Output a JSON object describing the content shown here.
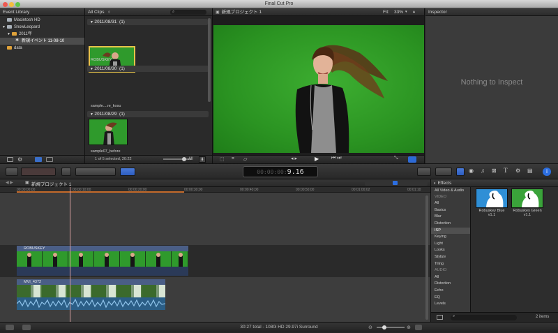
{
  "window": {
    "title": "Final Cut Pro"
  },
  "event_library": {
    "title": "Event Library",
    "items": [
      {
        "label": "Macintosh HD"
      },
      {
        "label": "SnowLeopard"
      },
      {
        "label": "2011年"
      },
      {
        "label": "新規イベント 11-08-10"
      },
      {
        "label": "data"
      }
    ]
  },
  "browser": {
    "filter": "All Clips",
    "groups": [
      {
        "date": "2011/08/31",
        "count": "(1)",
        "clip": "ROBUSKEY"
      },
      {
        "date": "2011/08/30",
        "count": "(1)",
        "clip": "sample....re_kosu"
      },
      {
        "date": "2011/08/29",
        "count": "(1)",
        "clip": "sample07_before"
      }
    ],
    "selection_status": "1 of 5 selected, 20:22",
    "filter_menu": "All"
  },
  "viewer": {
    "project_name": "新規プロジェクト 1",
    "fit_label": "Fit:",
    "zoom": "33%"
  },
  "inspector": {
    "title": "Inspector",
    "empty_text": "Nothing to Inspect"
  },
  "toolbar": {
    "timecode": "9.16"
  },
  "timeline": {
    "project_name": "新規プロジェクト 1",
    "ruler": [
      "00:00:00;00",
      "00:00:10;00",
      "00:00:20;00",
      "00:00:30;00",
      "00:00:40;00",
      "00:00:50;00",
      "00:01:00;02",
      "00:01:10"
    ],
    "connected_clip": "ROBUSKEY",
    "primary_clip": "MVI_4372"
  },
  "effects": {
    "title": "Effects",
    "top_label": "All Video & Audio",
    "categories": [
      {
        "label": "VIDEO",
        "header": true
      },
      {
        "label": "All"
      },
      {
        "label": "Basics"
      },
      {
        "label": "Blur"
      },
      {
        "label": "Distortion"
      },
      {
        "label": "ISP",
        "selected": true
      },
      {
        "label": "Keying"
      },
      {
        "label": "Light"
      },
      {
        "label": "Looks"
      },
      {
        "label": "Stylize"
      },
      {
        "label": "Tiling"
      },
      {
        "label": "AUDIO",
        "header": true
      },
      {
        "label": "All"
      },
      {
        "label": "Distortion"
      },
      {
        "label": "Echo"
      },
      {
        "label": "EQ"
      },
      {
        "label": "Levels"
      }
    ],
    "items": [
      {
        "label": "Robuskey Blue v1.1",
        "color": "#2f8fd6"
      },
      {
        "label": "Robuskey Green v1.1",
        "color": "#3aa33a"
      }
    ],
    "count": "2 items"
  },
  "status": {
    "summary": "30:27 total - 1080i HD 29.97i Surround"
  }
}
